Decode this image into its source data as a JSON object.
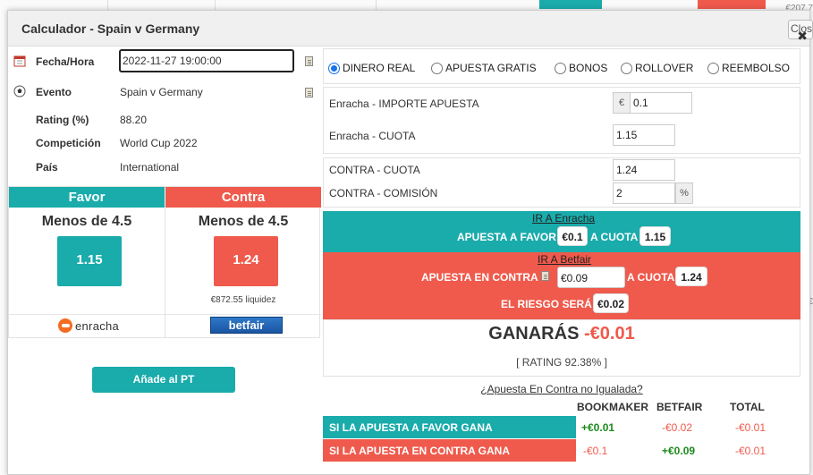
{
  "background": {
    "edge_text_top": "€207.7",
    "edge_text_mid": "€"
  },
  "dialog": {
    "title": "Calculador - Spain v Germany",
    "close_label": "Close"
  },
  "info": {
    "date_label": "Fecha/Hora",
    "date_value": "2022-11-27 19:00:00",
    "event_label": "Evento",
    "event_value": "Spain v Germany",
    "rating_label": "Rating (%)",
    "rating_value": "88.20",
    "competition_label": "Competición",
    "competition_value": "World Cup 2022",
    "country_label": "País",
    "country_value": "International"
  },
  "favor": {
    "header": "Favor",
    "market": "Menos de 4.5",
    "odds": "1.15",
    "bookmaker": "enracha"
  },
  "contra": {
    "header": "Contra",
    "market": "Menos de 4.5",
    "odds": "1.24",
    "liquidity": "€872.55 liquidez",
    "exchange": "betfair"
  },
  "add_pt_label": "Añade al PT",
  "bet_types": [
    {
      "label": "DINERO REAL",
      "checked": true
    },
    {
      "label": "APUESTA GRATIS",
      "checked": false
    },
    {
      "label": "BONOS",
      "checked": false
    },
    {
      "label": "ROLLOVER",
      "checked": false
    },
    {
      "label": "REEMBOLSO",
      "checked": false
    }
  ],
  "back_fields": {
    "stake_label": "Enracha - IMPORTE APUESTA",
    "currency": "€",
    "stake_value": "0.1",
    "odds_label": "Enracha - CUOTA",
    "odds_value": "1.15"
  },
  "lay_fields": {
    "odds_label": "CONTRA - CUOTA",
    "odds_value": "1.24",
    "commission_label": "CONTRA - COMISIÓN",
    "commission_value": "2",
    "percent": "%"
  },
  "favor_band": {
    "link": "IR A Enracha",
    "bet_text": "APUESTA A FAVOR",
    "bet_value": "€0.1",
    "odds_text": "A CUOTA",
    "odds_value": "1.15"
  },
  "contra_band": {
    "link": "IR A Betfair",
    "bet_text": "APUESTA EN CONTRA",
    "bet_value": "€0.09",
    "odds_text": "A CUOTA",
    "odds_value": "1.24",
    "risk_text": "EL RIESGO SERÁ",
    "risk_value": "€0.02"
  },
  "result": {
    "label": "GANARÁS",
    "value": "-€0.01",
    "rating": "[ RATING 92.38% ]"
  },
  "unmatched_link": "¿Apuesta En Contra no Igualada?",
  "outcomes": {
    "headers": [
      "BOOKMAKER",
      "BETFAIR",
      "TOTAL"
    ],
    "rows": [
      {
        "label": "SI LA APUESTA A FAVOR GANA",
        "bookmaker": "+€0.01",
        "betfair": "-€0.02",
        "total": "-€0.01"
      },
      {
        "label": "SI LA APUESTA EN CONTRA GANA",
        "bookmaker": "-€0.1",
        "betfair": "+€0.09",
        "total": "-€0.01"
      }
    ]
  },
  "colors": {
    "favor": "#1aabab",
    "contra": "#ef5a4c",
    "positive": "#1b8a1b"
  }
}
